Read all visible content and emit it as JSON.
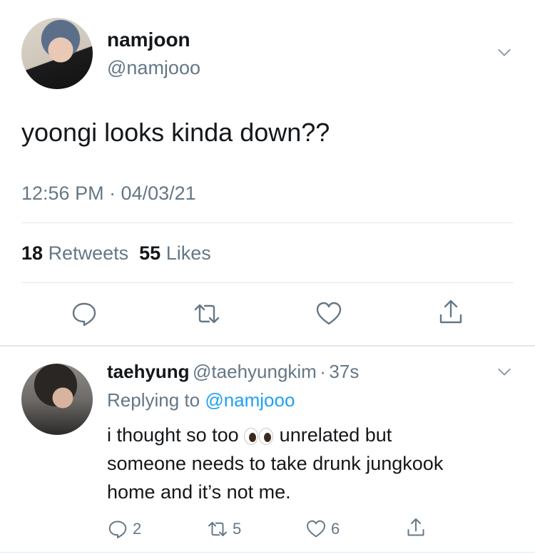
{
  "main_tweet": {
    "display_name": "namjoon",
    "handle": "@namjooo",
    "text": "yoongi looks kinda down??",
    "timestamp": "12:56 PM · 04/03/21",
    "retweets_count": "18",
    "retweets_label": "Retweets",
    "likes_count": "55",
    "likes_label": "Likes"
  },
  "reply": {
    "display_name": "taehyung",
    "handle": "@taehyungkim",
    "separator": "·",
    "time_ago": "37s",
    "replying_prefix": "Replying to",
    "replying_handle": "@namjooo",
    "text_part1": "i thought so too",
    "emoji": "👀",
    "text_part2": "unrelated but",
    "text_line2": "someone needs to take drunk jungkook",
    "text_line3": "home and it’s not me.",
    "reply_count": "2",
    "retweet_count": "5",
    "like_count": "6"
  },
  "icons": {
    "chevron": "chevron-down-icon",
    "reply": "comment-icon",
    "retweet": "retweet-icon",
    "like": "heart-icon",
    "share": "share-icon"
  },
  "colors": {
    "primary_text": "#14171a",
    "secondary_text": "#657786",
    "link": "#1da1f2",
    "divider": "#e1e8ed"
  }
}
